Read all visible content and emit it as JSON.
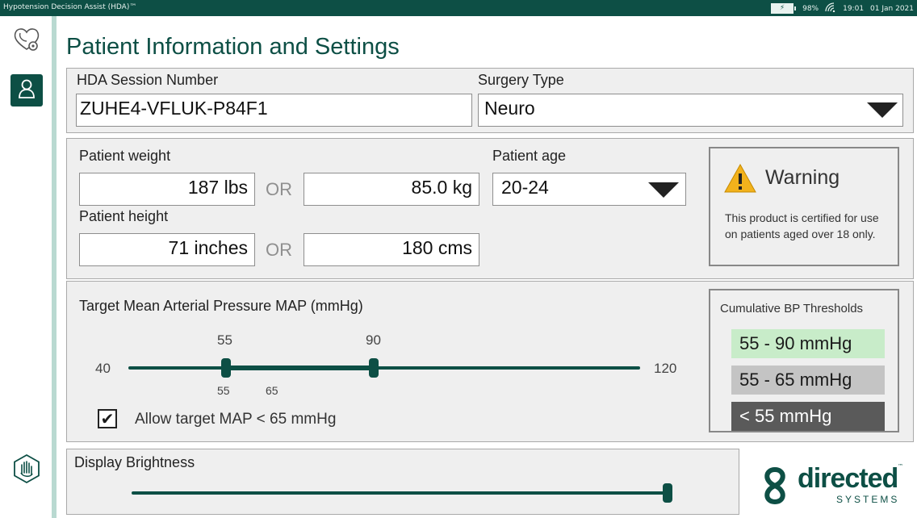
{
  "status_bar": {
    "app_title": "Hypotension Decision Assist (HDA)™",
    "battery_percent": "98%",
    "time": "19:01",
    "date": "01 Jan 2021"
  },
  "rail": {
    "items": [
      {
        "icon": "heart-stethoscope-icon"
      },
      {
        "icon": "person-icon",
        "active": true
      },
      {
        "icon": "hand-stop-icon"
      }
    ]
  },
  "page_title": "Patient Information and Settings",
  "session": {
    "session_label": "HDA Session Number",
    "session_value": "ZUHE4-VFLUK-P84F1",
    "surgery_label": "Surgery Type",
    "surgery_value": "Neuro"
  },
  "patient": {
    "weight_label": "Patient weight",
    "weight_lbs": "187",
    "weight_lbs_unit": "lbs",
    "weight_kg": "85.0",
    "weight_kg_unit": "kg",
    "or_label": "OR",
    "height_label": "Patient height",
    "height_in": "71",
    "height_in_unit": "inches",
    "height_cm": "180",
    "height_cm_unit": "cms",
    "age_label": "Patient age",
    "age_value": "20-24"
  },
  "warning": {
    "title": "Warning",
    "text": "This product is certified for use on patients aged over 18 only."
  },
  "map": {
    "label": "Target Mean Arterial Pressure MAP (mmHg)",
    "min_label": "40",
    "max_label": "120",
    "low_handle_label": "55",
    "high_handle_label": "90",
    "below_low_label": "55",
    "below_mid_label": "65",
    "range_min": 40,
    "range_max": 120,
    "low_value": 55,
    "high_value": 90,
    "allow_checked": true,
    "allow_label": "Allow target MAP < 65 mmHg"
  },
  "thresholds": {
    "title": "Cumulative BP Thresholds",
    "items": [
      {
        "label": "55 - 90 mmHg",
        "bg": "#c8ecc9",
        "fg": "#1a1a1a"
      },
      {
        "label": "55 - 65 mmHg",
        "bg": "#c4c4c4",
        "fg": "#1a1a1a"
      },
      {
        "label": "< 55 mmHg",
        "bg": "#5a5a5a",
        "fg": "#ffffff"
      }
    ]
  },
  "brightness": {
    "label": "Display Brightness",
    "level": 1.0
  },
  "logo": {
    "word": "directed",
    "tm": "™",
    "sub": "SYSTEMS"
  },
  "colors": {
    "primary": "#0d4f45",
    "accent_rail": "#b9d9d1",
    "panel_bg": "#efefef",
    "warning_yellow": "#f2b21c"
  }
}
